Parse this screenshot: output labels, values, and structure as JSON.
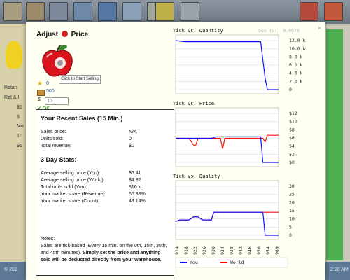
{
  "background": {
    "sidebar_texts": [
      "Ratan",
      "Rat & I",
      "$1",
      "$",
      "Mo",
      "Tr",
      "95"
    ],
    "footer_left": "© 201",
    "footer_right": "2:20 AM"
  },
  "dialog": {
    "title_prefix": "Adjust",
    "title_suffix": "Price",
    "tooltip": "Click to Start Selling",
    "stars": "0",
    "stock": "500",
    "price_symbol": "$",
    "price_value": "10",
    "ok_label": "OK",
    "close": "×"
  },
  "sales": {
    "recent_heading": "Your Recent Sales (15 Min.)",
    "recent_rows": [
      {
        "label": "Sales price:",
        "value": "N/A"
      },
      {
        "label": "Units sold:",
        "value": "0"
      },
      {
        "label": "Total revenue:",
        "value": "$0"
      }
    ],
    "day_heading": "3 Day Stats:",
    "day_rows": [
      {
        "label": "Average selling price (You):",
        "value": "$6.41"
      },
      {
        "label": "Average selling price (World):",
        "value": "$4.82"
      },
      {
        "label": "Total units sold (You):",
        "value": "816 k"
      },
      {
        "label": "Your market share (Revenue):",
        "value": "65.38%"
      },
      {
        "label": "Your market share (Count):",
        "value": "49.14%"
      }
    ],
    "notes_title": "Notes:",
    "notes_plain": "Sales are tick-based (Every 15 min. on the 0th, 15th, 30th, and 45th minutes).",
    "notes_bold": "Simply set the price and anything sold will be deducted directly from your warehouse."
  },
  "chart_data": [
    {
      "type": "line",
      "title": "Tick vs. Quantity",
      "annotation": "Geo (s): 0.0076",
      "y_ticks": [
        "12.0 k",
        "10.0 k",
        "8.0 k",
        "6.0 k",
        "4.0 k",
        "2.0 k",
        "0"
      ],
      "ylim": [
        0,
        13000
      ],
      "x": [
        914,
        918,
        922,
        926,
        930,
        934,
        938,
        942,
        946,
        950,
        952,
        954,
        955,
        960
      ],
      "series": [
        {
          "name": "You",
          "values": [
            13000,
            12700,
            12700,
            12700,
            12700,
            12700,
            12700,
            12700,
            12700,
            12700,
            12700,
            3000,
            0,
            0
          ]
        }
      ]
    },
    {
      "type": "line",
      "title": "Tick vs. Price",
      "y_ticks": [
        "$12",
        "$10",
        "$8",
        "$6",
        "$4",
        "$2",
        "$0"
      ],
      "ylim": [
        0,
        13
      ],
      "x": [
        914,
        916,
        918,
        920,
        922,
        923,
        924,
        925,
        926,
        928,
        930,
        932,
        934,
        935,
        936,
        937,
        938,
        940,
        942,
        944,
        946,
        948,
        950,
        952,
        953,
        954,
        955,
        957,
        960
      ],
      "series": [
        {
          "name": "You",
          "values": [
            6.4,
            6.4,
            6.4,
            6.4,
            6.4,
            6.4,
            6.4,
            6.4,
            6.4,
            6.4,
            6.4,
            6.8,
            6.8,
            6.8,
            6.8,
            6.8,
            6.8,
            6.8,
            6.8,
            6.8,
            6.8,
            6.8,
            6.8,
            6.8,
            0,
            0,
            0,
            0,
            0
          ]
        },
        {
          "name": "World",
          "values": [
            6.4,
            6.4,
            6.4,
            6.4,
            4.6,
            4.6,
            6.4,
            6.4,
            6.4,
            6.4,
            6.4,
            6.4,
            6.4,
            3.6,
            6.4,
            6.4,
            6.4,
            6.4,
            6.4,
            6.4,
            6.4,
            6.4,
            6.4,
            6.4,
            6.4,
            5.4,
            7.2,
            7.2,
            7.2
          ]
        }
      ]
    },
    {
      "type": "line",
      "title": "Tick vs. Quality",
      "y_ticks": [
        "30",
        "25",
        "20",
        "15",
        "10",
        "5",
        "0"
      ],
      "ylim": [
        0,
        32
      ],
      "x": [
        914,
        916,
        918,
        920,
        922,
        923,
        924,
        926,
        928,
        930,
        931,
        932,
        940,
        950,
        953,
        954,
        955,
        960
      ],
      "series": [
        {
          "name": "You",
          "values": [
            9,
            10,
            10,
            10,
            12,
            12,
            12,
            10,
            10,
            10,
            15,
            15,
            15,
            15,
            15,
            0,
            0,
            0
          ]
        },
        {
          "name": "World",
          "values": [
            9,
            10,
            10,
            10,
            12,
            12,
            12,
            10,
            10,
            10,
            15,
            15,
            15,
            15,
            15,
            15,
            15,
            15
          ]
        }
      ]
    }
  ],
  "x_axis_ticks": [
    "914",
    "918",
    "922",
    "926",
    "930",
    "934",
    "938",
    "942",
    "946",
    "950",
    "954",
    "989"
  ],
  "legend": [
    {
      "name": "You",
      "color": "#1010ff"
    },
    {
      "name": "World",
      "color": "#ff1010"
    }
  ],
  "colors": {
    "you": "#1010ff",
    "world": "#ff1010",
    "grid": "#cccccc"
  }
}
